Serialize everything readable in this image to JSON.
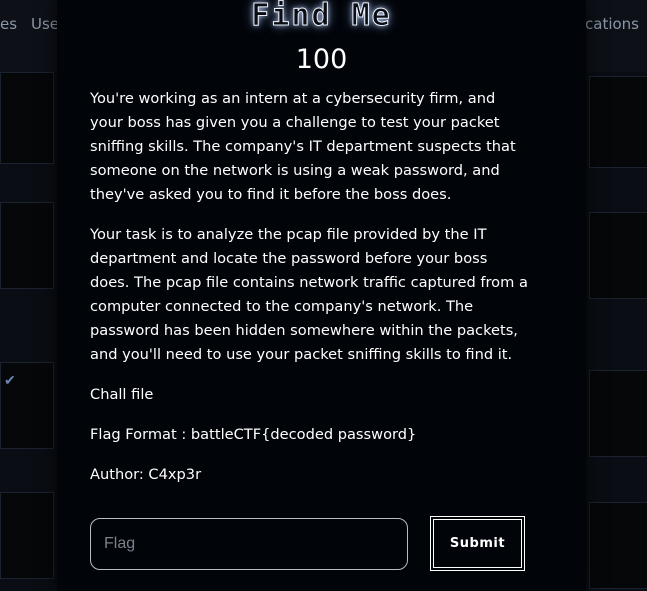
{
  "background": {
    "nav_left_items": [
      "es",
      "Use"
    ],
    "nav_right_item": "Notifications"
  },
  "modal": {
    "title": "Find Me",
    "points": "100",
    "description_paragraphs": [
      "You're working as an intern at a cybersecurity firm, and your boss has given you a challenge to test your packet sniffing skills. The company's IT department suspects that someone on the network is using a weak password, and they've asked you to find it before the boss does.",
      "Your task is to analyze the pcap file provided by the IT department and locate the password before your boss does. The pcap file contains network traffic captured from a computer connected to the company's network. The password has been hidden somewhere within the packets, and you'll need to use your packet sniffing skills to find it."
    ],
    "chall_file_label": "Chall file",
    "flag_format": "Flag Format : battleCTF{decoded password}",
    "author": "Author: C4xp3r",
    "flag_input": {
      "value": "",
      "placeholder": "Flag"
    },
    "submit_label": "Submit"
  },
  "colors": {
    "modal_bg": "#010409",
    "text": "#ffffff",
    "title_glow": "#c8dcff",
    "input_border": "#b8bec8"
  }
}
